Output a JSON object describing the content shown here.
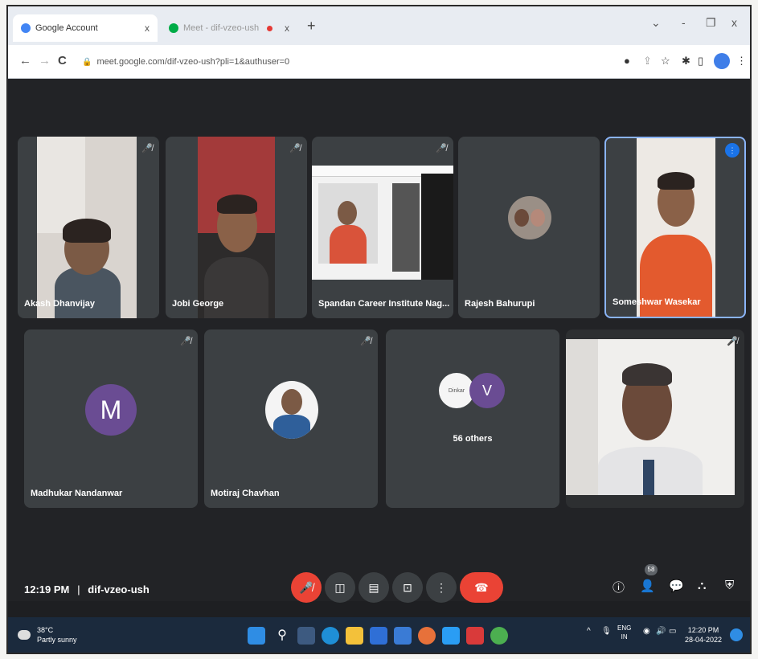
{
  "browser": {
    "tabs": [
      {
        "label": "Google Account",
        "close": "x"
      },
      {
        "label": "Meet - dif-vzeo-ush",
        "close": "x"
      }
    ],
    "new_tab": "+",
    "window": {
      "minimize": "-",
      "restore": "❐",
      "close": "x"
    },
    "url": "meet.google.com/dif-vzeo-ush?pli=1&authuser=0",
    "nav": {
      "back": "←",
      "forward": "→",
      "reload": "C"
    }
  },
  "meet": {
    "participants": [
      {
        "name": "Akash Dhanvijay",
        "muted": true
      },
      {
        "name": "Jobi George",
        "muted": true
      },
      {
        "name": "Spandan Career Institute Nag...",
        "muted": true
      },
      {
        "name": "Rajesh Bahurupi",
        "muted": true
      },
      {
        "name": "Someshwar Wasekar",
        "speaking": true
      },
      {
        "name": "Madhukar Nandanwar",
        "initial": "M",
        "muted": true
      },
      {
        "name": "Motiraj Chavhan",
        "muted": true
      },
      {
        "name": "",
        "muted": true
      }
    ],
    "others": {
      "label": "56 others",
      "initial": "V",
      "avatar_text": "Dinkar"
    },
    "time": "12:19 PM",
    "separator": "|",
    "meeting_code": "dif-vzeo-ush",
    "people_badge": "58"
  },
  "taskbar": {
    "temperature": "38°C",
    "weather": "Partly sunny",
    "lang_top": "ENG",
    "lang_bottom": "IN",
    "time": "12:20 PM",
    "date": "28-04-2022"
  },
  "colors": {
    "accent_red": "#ea4335",
    "button_grey": "#3c4043",
    "avatar_purple": "#6a4c93",
    "speaking_border": "#8ab4f8"
  }
}
